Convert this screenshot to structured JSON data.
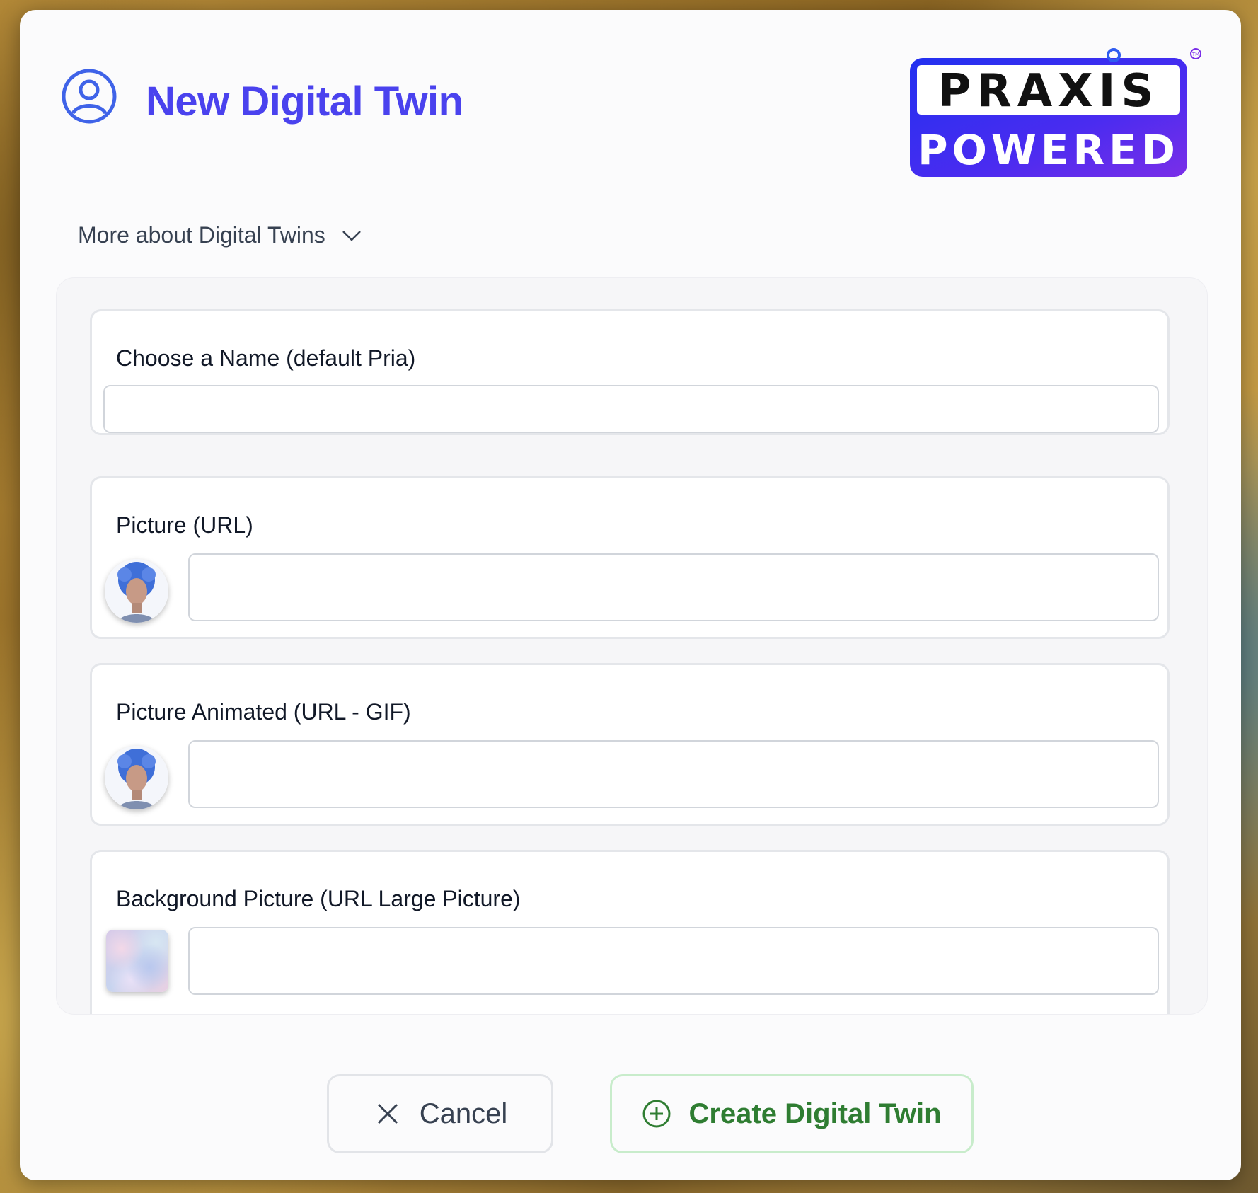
{
  "dialog": {
    "title": "New Digital Twin",
    "header_icon": "user-circle-icon",
    "logo": {
      "line1": "PRAXIS",
      "line2": "POWERED",
      "mark": "TM"
    },
    "more_toggle": {
      "label": "More about Digital Twins",
      "icon": "chevron-down-icon"
    }
  },
  "form": {
    "name": {
      "label": "Choose a Name (default Pria)",
      "value": "",
      "placeholder": ""
    },
    "picture": {
      "label": "Picture (URL)",
      "value": "",
      "placeholder": "",
      "preview": "avatar-image"
    },
    "picture_animated": {
      "label": "Picture Animated (URL - GIF)",
      "value": "",
      "placeholder": "",
      "preview": "avatar-image"
    },
    "background": {
      "label": "Background Picture (URL Large Picture)",
      "value": "",
      "placeholder": "",
      "preview": "background-thumbnail"
    }
  },
  "actions": {
    "cancel_label": "Cancel",
    "cancel_icon": "close-icon",
    "create_label": "Create Digital Twin",
    "create_icon": "plus-circle-icon"
  },
  "colors": {
    "accent": "#4a42ee",
    "create_text": "#2f7d32",
    "create_border": "#c8eccb"
  }
}
